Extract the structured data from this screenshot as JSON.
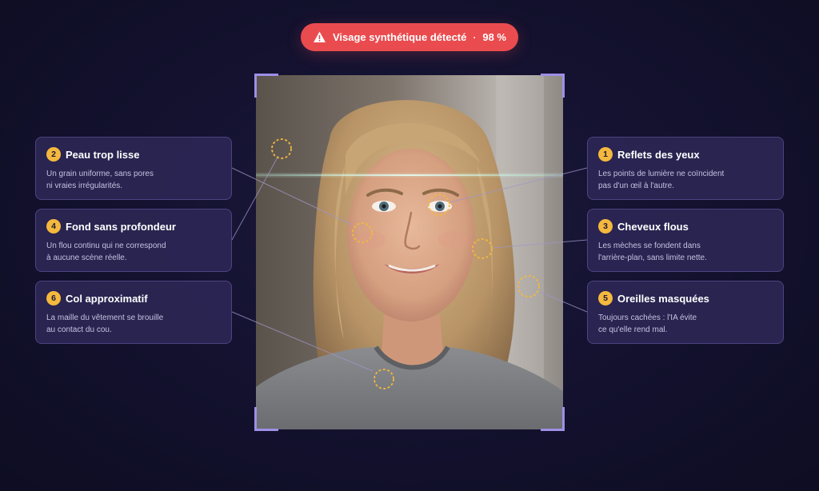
{
  "alert": {
    "icon": "warning-icon",
    "label": "Visage synthétique détecté",
    "separator": "·",
    "score": "98 %",
    "color": "#ea4b4e"
  },
  "photo": {
    "subject": "smiling woman with long blonde hair in grey top"
  },
  "accents": {
    "frame_corner": "#9f8fe6",
    "marker": "#f3b83d",
    "card_bg": "#2b2654"
  },
  "cards": {
    "c1": {
      "number": "1",
      "title": "Reflets des yeux",
      "description": "Les points de lumière ne coïncident\npas d'un œil à l'autre."
    },
    "c2": {
      "number": "2",
      "title": "Peau trop lisse",
      "description": "Un grain uniforme, sans pores\nni vraies irrégularités."
    },
    "c3": {
      "number": "3",
      "title": "Cheveux flous",
      "description": "Les mèches se fondent dans\nl'arrière-plan, sans limite nette."
    },
    "c4": {
      "number": "4",
      "title": "Fond sans profondeur",
      "description": "Un flou continu qui ne correspond\nà aucune scène réelle."
    },
    "c5": {
      "number": "5",
      "title": "Oreilles masquées",
      "description": "Toujours cachées : l'IA évite\nce qu'elle rend mal."
    },
    "c6": {
      "number": "6",
      "title": "Col approximatif",
      "description": "La maille du vêtement se brouille\nau contact du cou."
    }
  }
}
